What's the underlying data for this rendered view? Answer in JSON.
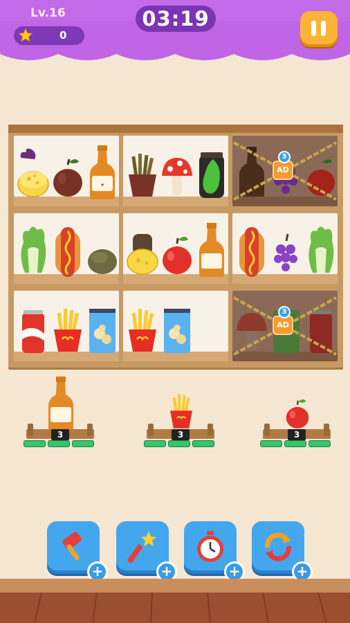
{
  "header": {
    "level_label": "Lv.16",
    "score": "0",
    "timer": "03:19",
    "colors": {
      "bar": "#c065e6",
      "pill": "#7a35b4",
      "pause": "#ffb238"
    }
  },
  "shelf": {
    "rows": [
      [
        {
          "locked": false,
          "items": [
            "cheese-icon",
            "apple-dark-icon",
            "soda-bottle-icon"
          ]
        },
        {
          "locked": false,
          "items": [
            "fries-dark-icon",
            "mushroom-icon",
            "mango-jar-icon"
          ]
        },
        {
          "locked": true,
          "ad_label": "AD",
          "unlock_count": "3",
          "items": [
            "bottle-dark-icon",
            "grapes-icon",
            "apple-icon"
          ]
        }
      ],
      [
        {
          "locked": false,
          "items": [
            "lettuce-icon",
            "hotdog-icon",
            "potato-icon"
          ]
        },
        {
          "locked": false,
          "items": [
            "cheese-stack-icon",
            "apple-icon",
            "soda-bottle-icon"
          ]
        },
        {
          "locked": false,
          "items": [
            "hotdog-icon",
            "grapes-icon",
            "lettuce-icon"
          ]
        }
      ],
      [
        {
          "locked": false,
          "items": [
            "soda-can-icon",
            "fries-icon",
            "chips-bag-icon"
          ]
        },
        {
          "locked": false,
          "items": [
            "fries-icon",
            "chips-bag-icon"
          ]
        },
        {
          "locked": true,
          "ad_label": "AD",
          "unlock_count": "3",
          "items": [
            "mushroom-icon",
            "chips-bag-icon",
            "soda-can-icon"
          ]
        }
      ]
    ]
  },
  "targets": [
    {
      "item": "soda-bottle-icon",
      "count": "3",
      "progress": 0
    },
    {
      "item": "fries-icon",
      "count": "3",
      "progress": 0
    },
    {
      "item": "apple-icon",
      "count": "3",
      "progress": 0
    }
  ],
  "tools": [
    {
      "name": "hammer-icon",
      "plus": "+"
    },
    {
      "name": "magic-wand-icon",
      "plus": "+"
    },
    {
      "name": "stopwatch-icon",
      "plus": "+"
    },
    {
      "name": "shuffle-icon",
      "plus": "+"
    }
  ]
}
